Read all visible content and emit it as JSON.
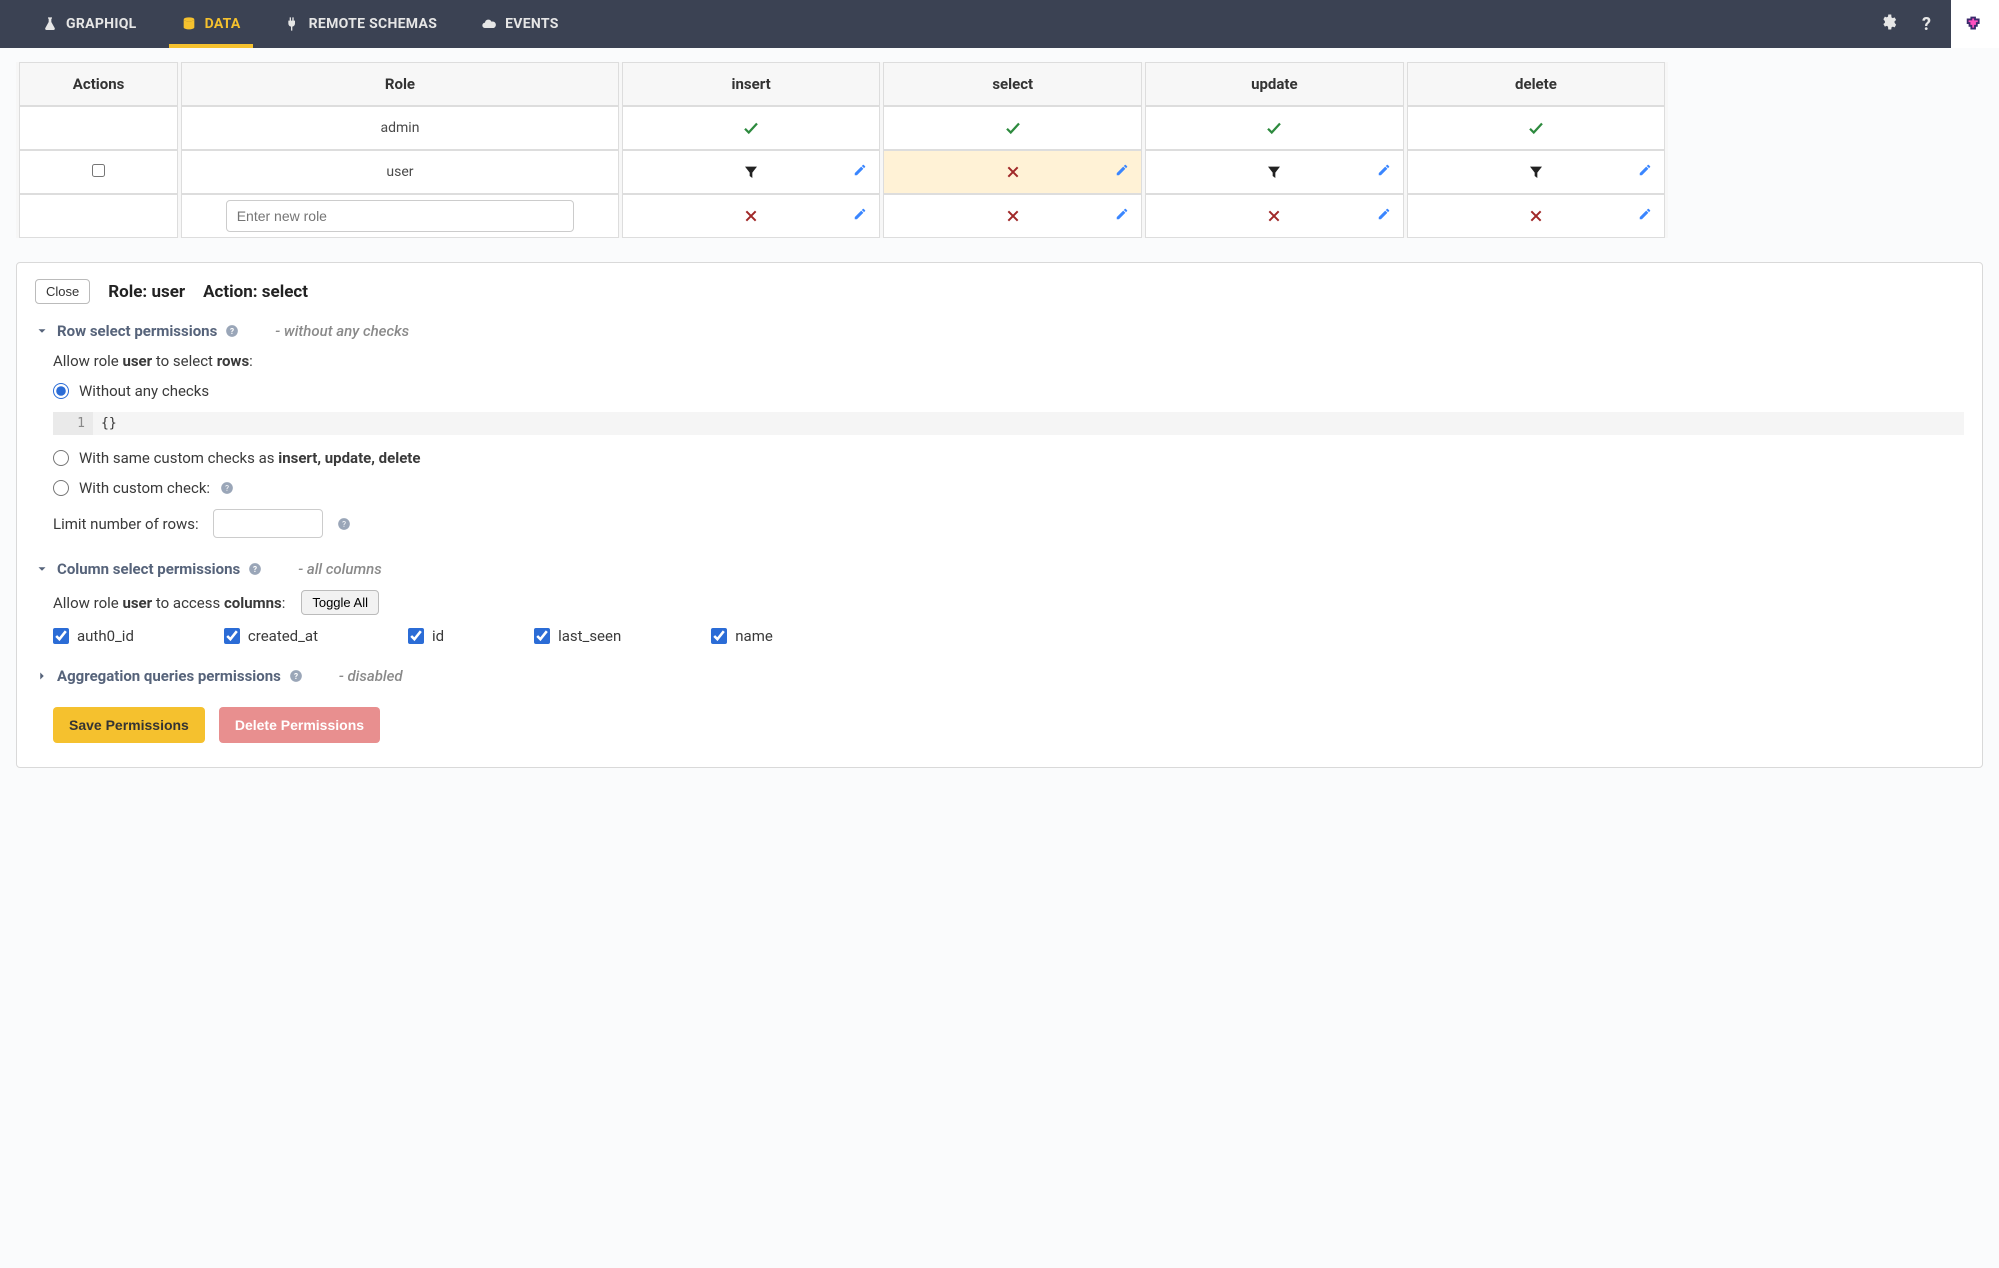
{
  "nav": {
    "items": [
      {
        "label": "GRAPHIQL"
      },
      {
        "label": "DATA"
      },
      {
        "label": "REMOTE SCHEMAS"
      },
      {
        "label": "EVENTS"
      }
    ]
  },
  "table": {
    "headers": {
      "actions": "Actions",
      "role": "Role",
      "insert": "insert",
      "select": "select",
      "update": "update",
      "delete": "delete"
    },
    "rows": {
      "admin": {
        "role": "admin"
      },
      "user": {
        "role": "user"
      },
      "newrole_placeholder": "Enter new role"
    }
  },
  "panel": {
    "close": "Close",
    "role_label": "Role: ",
    "role_value": "user",
    "action_label": "Action: ",
    "action_value": "select"
  },
  "row_perm": {
    "title": "Row select permissions",
    "summary": "- without any checks",
    "desc_prefix": "Allow role ",
    "desc_role": "user",
    "desc_mid": " to select ",
    "desc_rows": "rows",
    "opt_without": "Without any checks",
    "code_line_no": "1",
    "code_text": "{}",
    "opt_same_prefix": "With same custom checks as ",
    "opt_same_bold": "insert, update, delete",
    "opt_custom": "With custom check:",
    "limit_label": "Limit number of rows:"
  },
  "col_perm": {
    "title": "Column select permissions",
    "summary": "- all columns",
    "desc_prefix": "Allow role ",
    "desc_role": "user",
    "desc_mid": " to access ",
    "desc_cols": "columns",
    "toggle": "Toggle All",
    "columns": [
      "auth0_id",
      "created_at",
      "id",
      "last_seen",
      "name"
    ]
  },
  "agg_perm": {
    "title": "Aggregation queries permissions",
    "summary": "- disabled"
  },
  "buttons": {
    "save": "Save Permissions",
    "delete": "Delete Permissions"
  }
}
